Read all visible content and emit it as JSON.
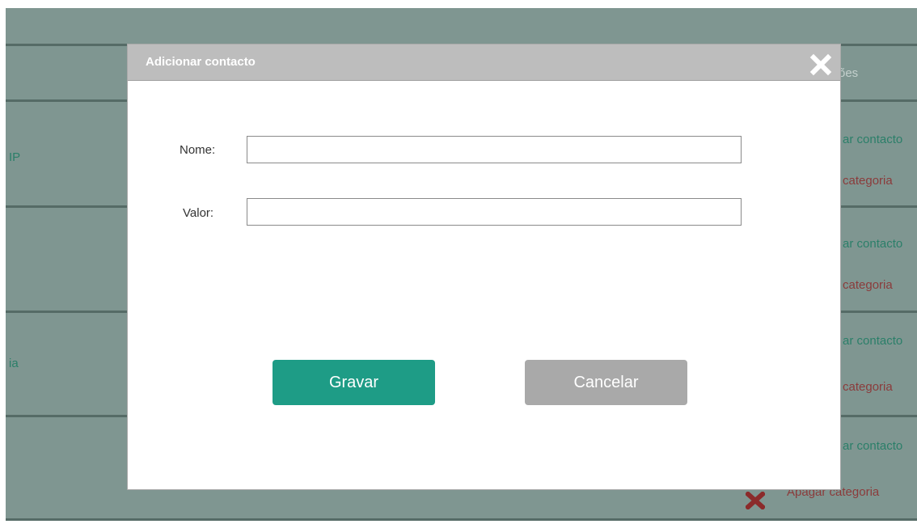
{
  "background": {
    "header_text": "ões",
    "rows": [
      {
        "left_text": "IP",
        "action_contact": "ar contacto",
        "action_category": "categoria"
      },
      {
        "left_text": "",
        "action_contact": "ar contacto",
        "action_category": "categoria"
      },
      {
        "left_text": "ia",
        "action_contact": "ar contacto",
        "action_category": "categoria"
      },
      {
        "left_text": "",
        "action_contact": "ar contacto",
        "action_category": "Apagar categoria"
      }
    ],
    "icons": {
      "delete": "x-icon"
    }
  },
  "modal": {
    "title": "Adicionar contacto",
    "close_icon": "close-icon",
    "fields": {
      "name_label": "Nome:",
      "name_value": "",
      "value_label": "Valor:",
      "value_value": ""
    },
    "buttons": {
      "save": "Gravar",
      "cancel": "Cancelar"
    }
  },
  "colors": {
    "overlay_bg": "#7f9691",
    "header_bg": "#bdbdbd",
    "save_bg": "#1e9c86",
    "cancel_bg": "#a9a9a9",
    "action_green": "#2b7f69",
    "action_red": "#8b3b3b"
  }
}
